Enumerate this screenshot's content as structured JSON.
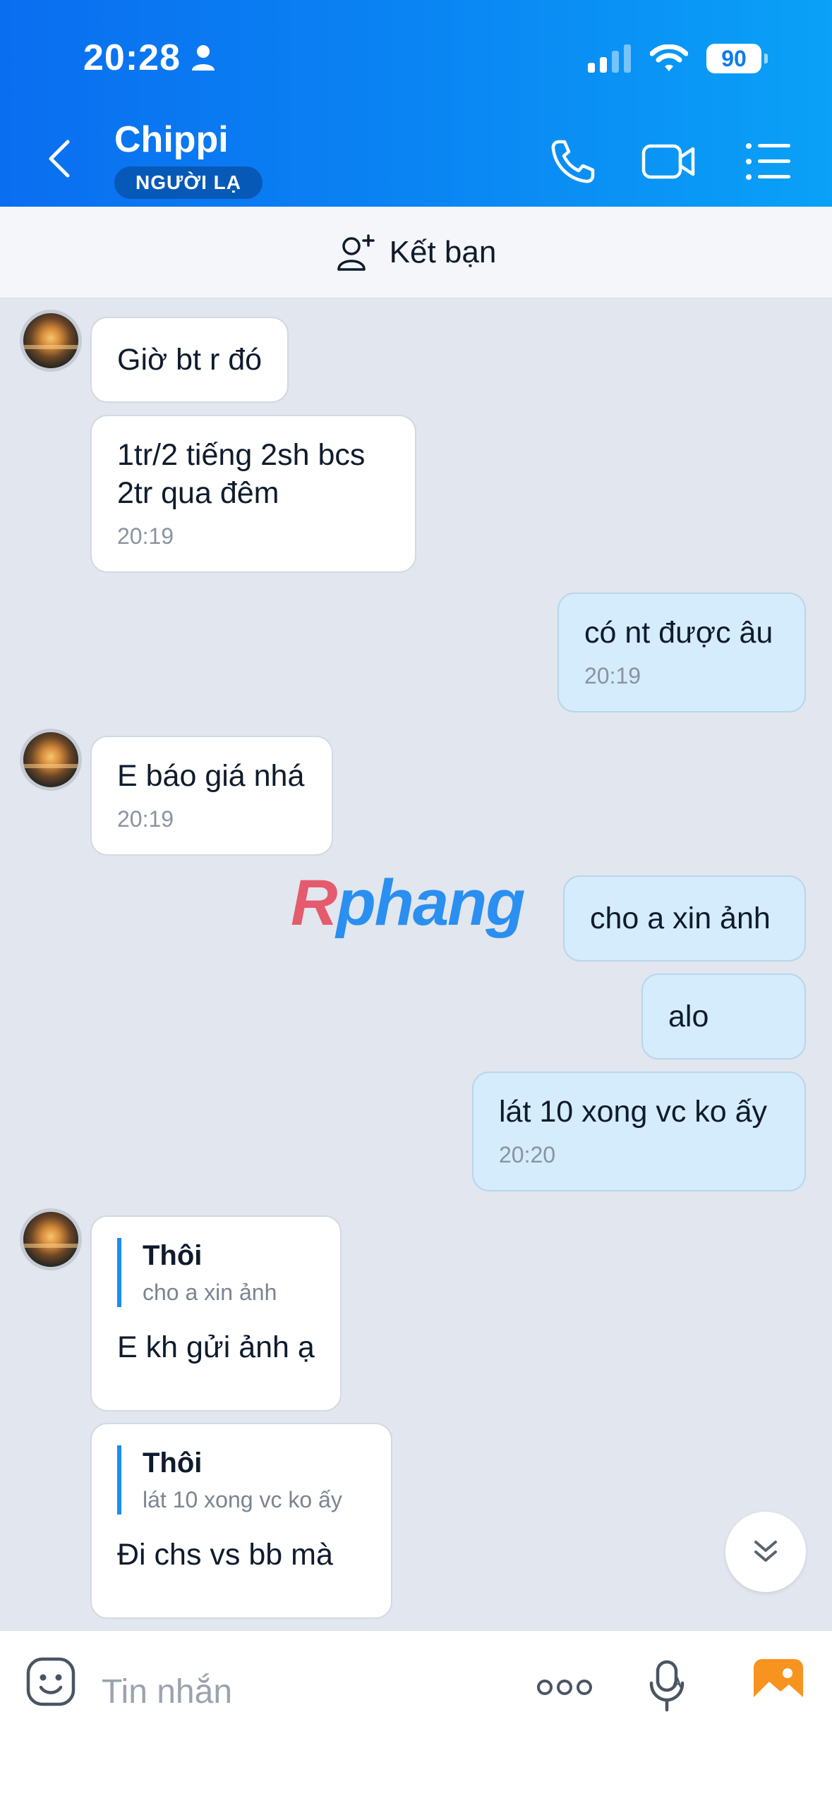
{
  "status_bar": {
    "time": "20:28",
    "battery": "90"
  },
  "header": {
    "contact_name": "Chippi",
    "badge": "NGƯỜI LẠ"
  },
  "add_friend": {
    "label": "Kết bạn"
  },
  "messages": [
    {
      "dir": "in",
      "text": "Giờ bt r đó"
    },
    {
      "dir": "in",
      "text_lines": [
        "1tr/2 tiếng 2sh bcs",
        "2tr qua đêm"
      ],
      "time": "20:19"
    },
    {
      "dir": "out",
      "text": "có nt được âu",
      "time": "20:19"
    },
    {
      "dir": "in",
      "text": "E báo giá nhá",
      "time": "20:19"
    },
    {
      "dir": "out",
      "text": "cho a xin ảnh"
    },
    {
      "dir": "out",
      "text": "alo"
    },
    {
      "dir": "out",
      "text": "lát 10 xong vc ko ấy",
      "time": "20:20"
    },
    {
      "dir": "in",
      "quote_name": "Thôi",
      "quote_text": "cho a xin ảnh",
      "text": "E kh gửi ảnh ạ"
    },
    {
      "dir": "in",
      "quote_name": "Thôi",
      "quote_text": "lát 10 xong vc ko ấy",
      "text": "Đi chs vs bb mà"
    }
  ],
  "watermark": {
    "first": "R",
    "rest": "phang"
  },
  "input": {
    "placeholder": "Tin nhắn"
  },
  "colors": {
    "header_start": "#0a6ef0",
    "header_end": "#0aa1f7",
    "outgoing_bubble": "#d4ecfb",
    "incoming_bubble": "#ffffff",
    "quote_bar": "#1a8cf5",
    "photo_button": "#f7931e"
  }
}
